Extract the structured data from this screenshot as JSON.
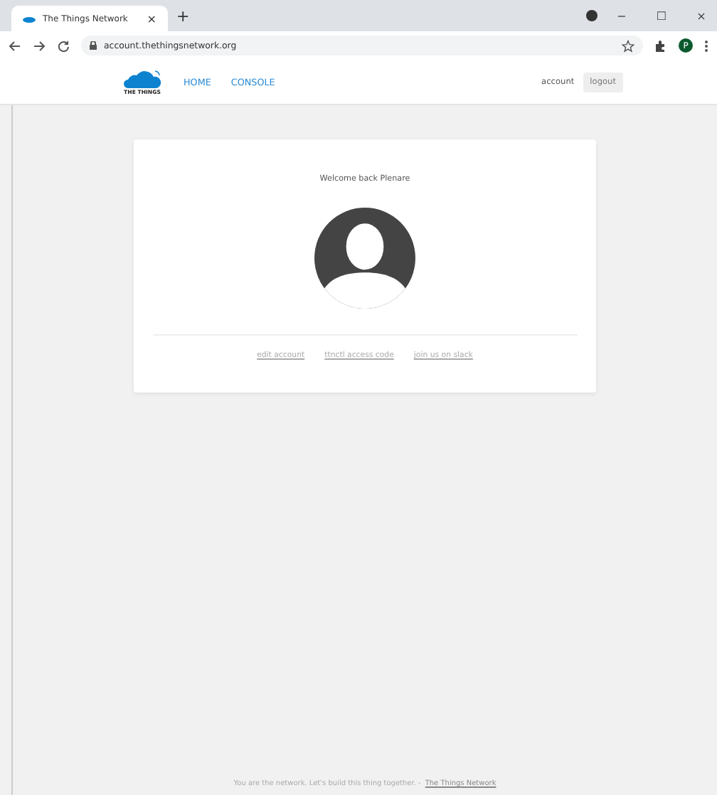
{
  "browser": {
    "tab_title": "The Things Network",
    "tab_close": "×",
    "new_tab": "+",
    "url": "account.thethingsnetwork.org",
    "profile_initial": "P",
    "window_controls": [
      "−",
      "☐",
      "×"
    ]
  },
  "nav": {
    "logo_text": "THE THINGS",
    "links": [
      {
        "label": "HOME"
      },
      {
        "label": "CONSOLE"
      }
    ],
    "account": "account",
    "logout": "logout"
  },
  "card": {
    "welcome": "Welcome back Plenare",
    "links": [
      "edit account",
      "ttnctl access code",
      "join us on slack"
    ]
  },
  "footer": {
    "text": "You are the network. Let's build this thing together. -",
    "link": "The Things Network"
  }
}
